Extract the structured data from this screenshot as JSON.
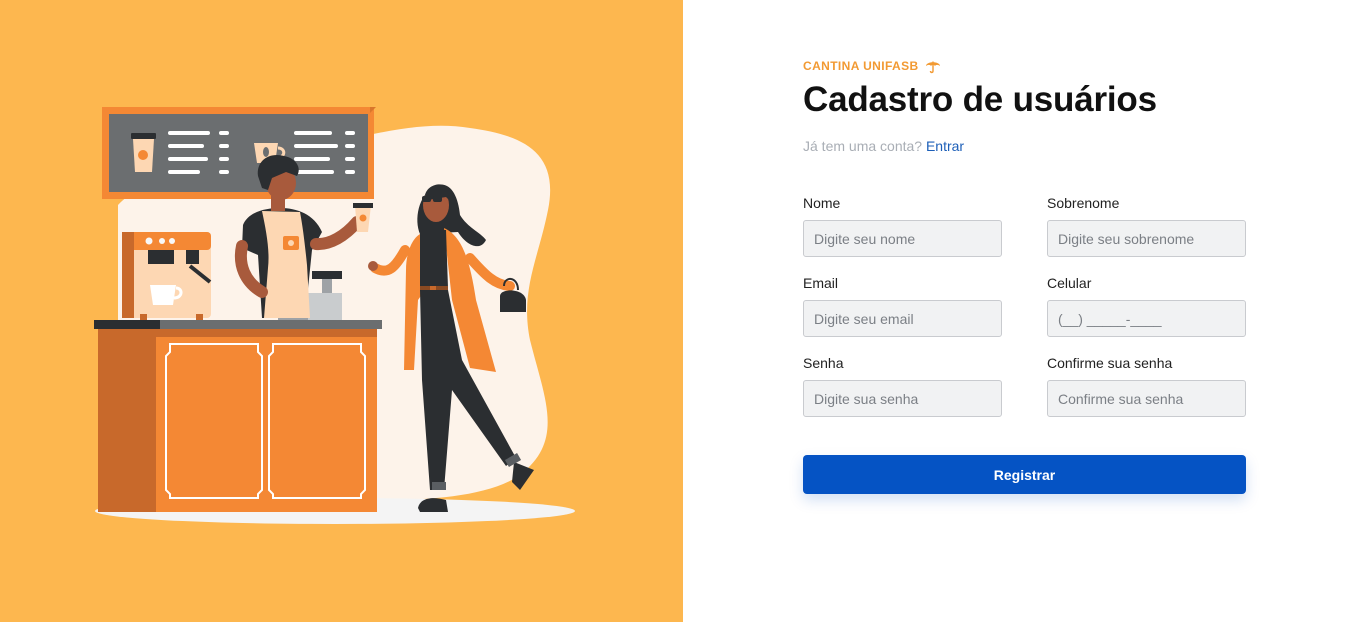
{
  "brand": {
    "name": "CANTINA UNIFASB",
    "icon": "umbrella-icon",
    "color": "#f29a33"
  },
  "page_title": "Cadastro de usuários",
  "login_prompt": {
    "text": "Já tem uma conta?",
    "link_label": "Entrar"
  },
  "form": {
    "nome": {
      "label": "Nome",
      "placeholder": "Digite seu nome"
    },
    "sobrenome": {
      "label": "Sobrenome",
      "placeholder": "Digite seu sobrenome"
    },
    "email": {
      "label": "Email",
      "placeholder": "Digite seu email"
    },
    "celular": {
      "label": "Celular",
      "placeholder": "(__) _____-____"
    },
    "senha": {
      "label": "Senha",
      "placeholder": "Digite sua senha"
    },
    "confirmar_senha": {
      "label": "Confirme sua senha",
      "placeholder": "Confirme sua senha"
    }
  },
  "submit_label": "Registrar",
  "colors": {
    "illustration_bg": "#fdb74f",
    "primary": "#0553c4",
    "accent_orange": "#f48834"
  }
}
